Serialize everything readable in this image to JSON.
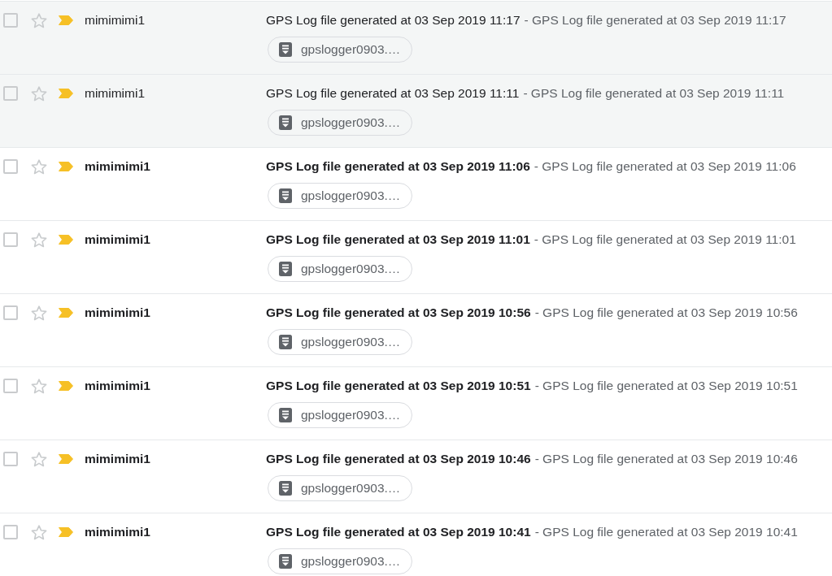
{
  "emails": [
    {
      "checked": false,
      "starred": false,
      "important": true,
      "unread": false,
      "sender": "mimimimi1",
      "subject": "GPS Log file generated at 03 Sep 2019 11:17",
      "snippet": "- GPS Log file generated at 03 Sep 2019 11:17",
      "attachments": [
        {
          "name": "gpslogger0903.…"
        }
      ]
    },
    {
      "checked": false,
      "starred": false,
      "important": true,
      "unread": false,
      "sender": "mimimimi1",
      "subject": "GPS Log file generated at 03 Sep 2019 11:11",
      "snippet": "- GPS Log file generated at 03 Sep 2019 11:11",
      "attachments": [
        {
          "name": "gpslogger0903.…"
        }
      ]
    },
    {
      "checked": false,
      "starred": false,
      "important": true,
      "unread": true,
      "sender": "mimimimi1",
      "subject": "GPS Log file generated at 03 Sep 2019 11:06",
      "snippet": "- GPS Log file generated at 03 Sep 2019 11:06",
      "attachments": [
        {
          "name": "gpslogger0903.…"
        }
      ]
    },
    {
      "checked": false,
      "starred": false,
      "important": true,
      "unread": true,
      "sender": "mimimimi1",
      "subject": "GPS Log file generated at 03 Sep 2019 11:01",
      "snippet": "- GPS Log file generated at 03 Sep 2019 11:01",
      "attachments": [
        {
          "name": "gpslogger0903.…"
        }
      ]
    },
    {
      "checked": false,
      "starred": false,
      "important": true,
      "unread": true,
      "sender": "mimimimi1",
      "subject": "GPS Log file generated at 03 Sep 2019 10:56",
      "snippet": "- GPS Log file generated at 03 Sep 2019 10:56",
      "attachments": [
        {
          "name": "gpslogger0903.…"
        }
      ]
    },
    {
      "checked": false,
      "starred": false,
      "important": true,
      "unread": true,
      "sender": "mimimimi1",
      "subject": "GPS Log file generated at 03 Sep 2019 10:51",
      "snippet": "- GPS Log file generated at 03 Sep 2019 10:51",
      "attachments": [
        {
          "name": "gpslogger0903.…"
        }
      ]
    },
    {
      "checked": false,
      "starred": false,
      "important": true,
      "unread": true,
      "sender": "mimimimi1",
      "subject": "GPS Log file generated at 03 Sep 2019 10:46",
      "snippet": "- GPS Log file generated at 03 Sep 2019 10:46",
      "attachments": [
        {
          "name": "gpslogger0903.…"
        }
      ]
    },
    {
      "checked": false,
      "starred": false,
      "important": true,
      "unread": true,
      "sender": "mimimimi1",
      "subject": "GPS Log file generated at 03 Sep 2019 10:41",
      "snippet": "- GPS Log file generated at 03 Sep 2019 10:41",
      "attachments": [
        {
          "name": "gpslogger0903.…"
        }
      ]
    }
  ]
}
